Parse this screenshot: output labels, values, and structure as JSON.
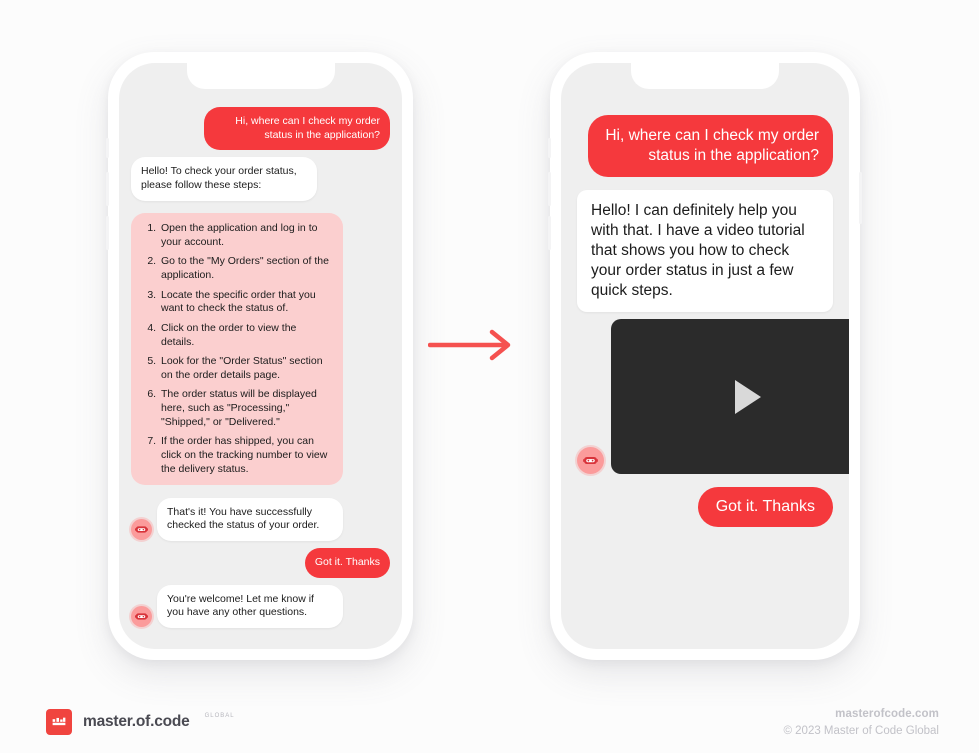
{
  "colors": {
    "background": "#fcfcfc",
    "accent_red": "#f5393d",
    "bubble_pink": "#fbcfcf",
    "bot_bubble": "#ffffff",
    "screen_bg": "#efefef",
    "video_bg": "#2b2b2b",
    "logo_red": "#f0443f"
  },
  "left_phone": {
    "name": "text-only-chatbot",
    "messages": [
      {
        "sender": "user",
        "text": "Hi, where can I check my order status in the application?"
      },
      {
        "sender": "bot",
        "text": "Hello! To check your order status, please follow these steps:"
      },
      {
        "sender": "bot",
        "type": "steps",
        "steps": [
          "Open the application and log in to your account.",
          "Go to the \"My Orders\" section of the application.",
          "Locate the specific order that you want to check the status of.",
          "Click on the order to view the details.",
          "Look for the \"Order Status\" section on the order details page.",
          "The order status will be displayed here, such as \"Processing,\" \"Shipped,\" or \"Delivered.\"",
          "If the order has shipped, you can click on the tracking number to view the delivery status."
        ]
      },
      {
        "sender": "bot",
        "text": "That's it! You have successfully checked the status of your order."
      },
      {
        "sender": "user",
        "text": "Got it. Thanks"
      },
      {
        "sender": "bot",
        "text": "You're welcome! Let me know if you have any other questions."
      }
    ]
  },
  "right_phone": {
    "name": "video-chatbot",
    "messages": [
      {
        "sender": "user",
        "text": "Hi, where can I check my order status in the application?"
      },
      {
        "sender": "bot",
        "text": "Hello! I can definitely help you with that. I have a video tutorial that shows you how to check your order status in just a few quick steps."
      },
      {
        "sender": "bot",
        "type": "video",
        "label": "video tutorial player"
      },
      {
        "sender": "user",
        "text": "Got it. Thanks"
      }
    ]
  },
  "arrow": {
    "name": "flow-arrow-right",
    "direction": "right"
  },
  "footer": {
    "logo_text": "master.of.code",
    "logo_sub": "GLOBAL",
    "website": "masterofcode.com",
    "copyright": "© 2023 Master of Code Global"
  },
  "icons": {
    "bot_avatar": "robot-face-icon",
    "play": "play-icon",
    "logo": "master-of-code-logo-icon"
  }
}
